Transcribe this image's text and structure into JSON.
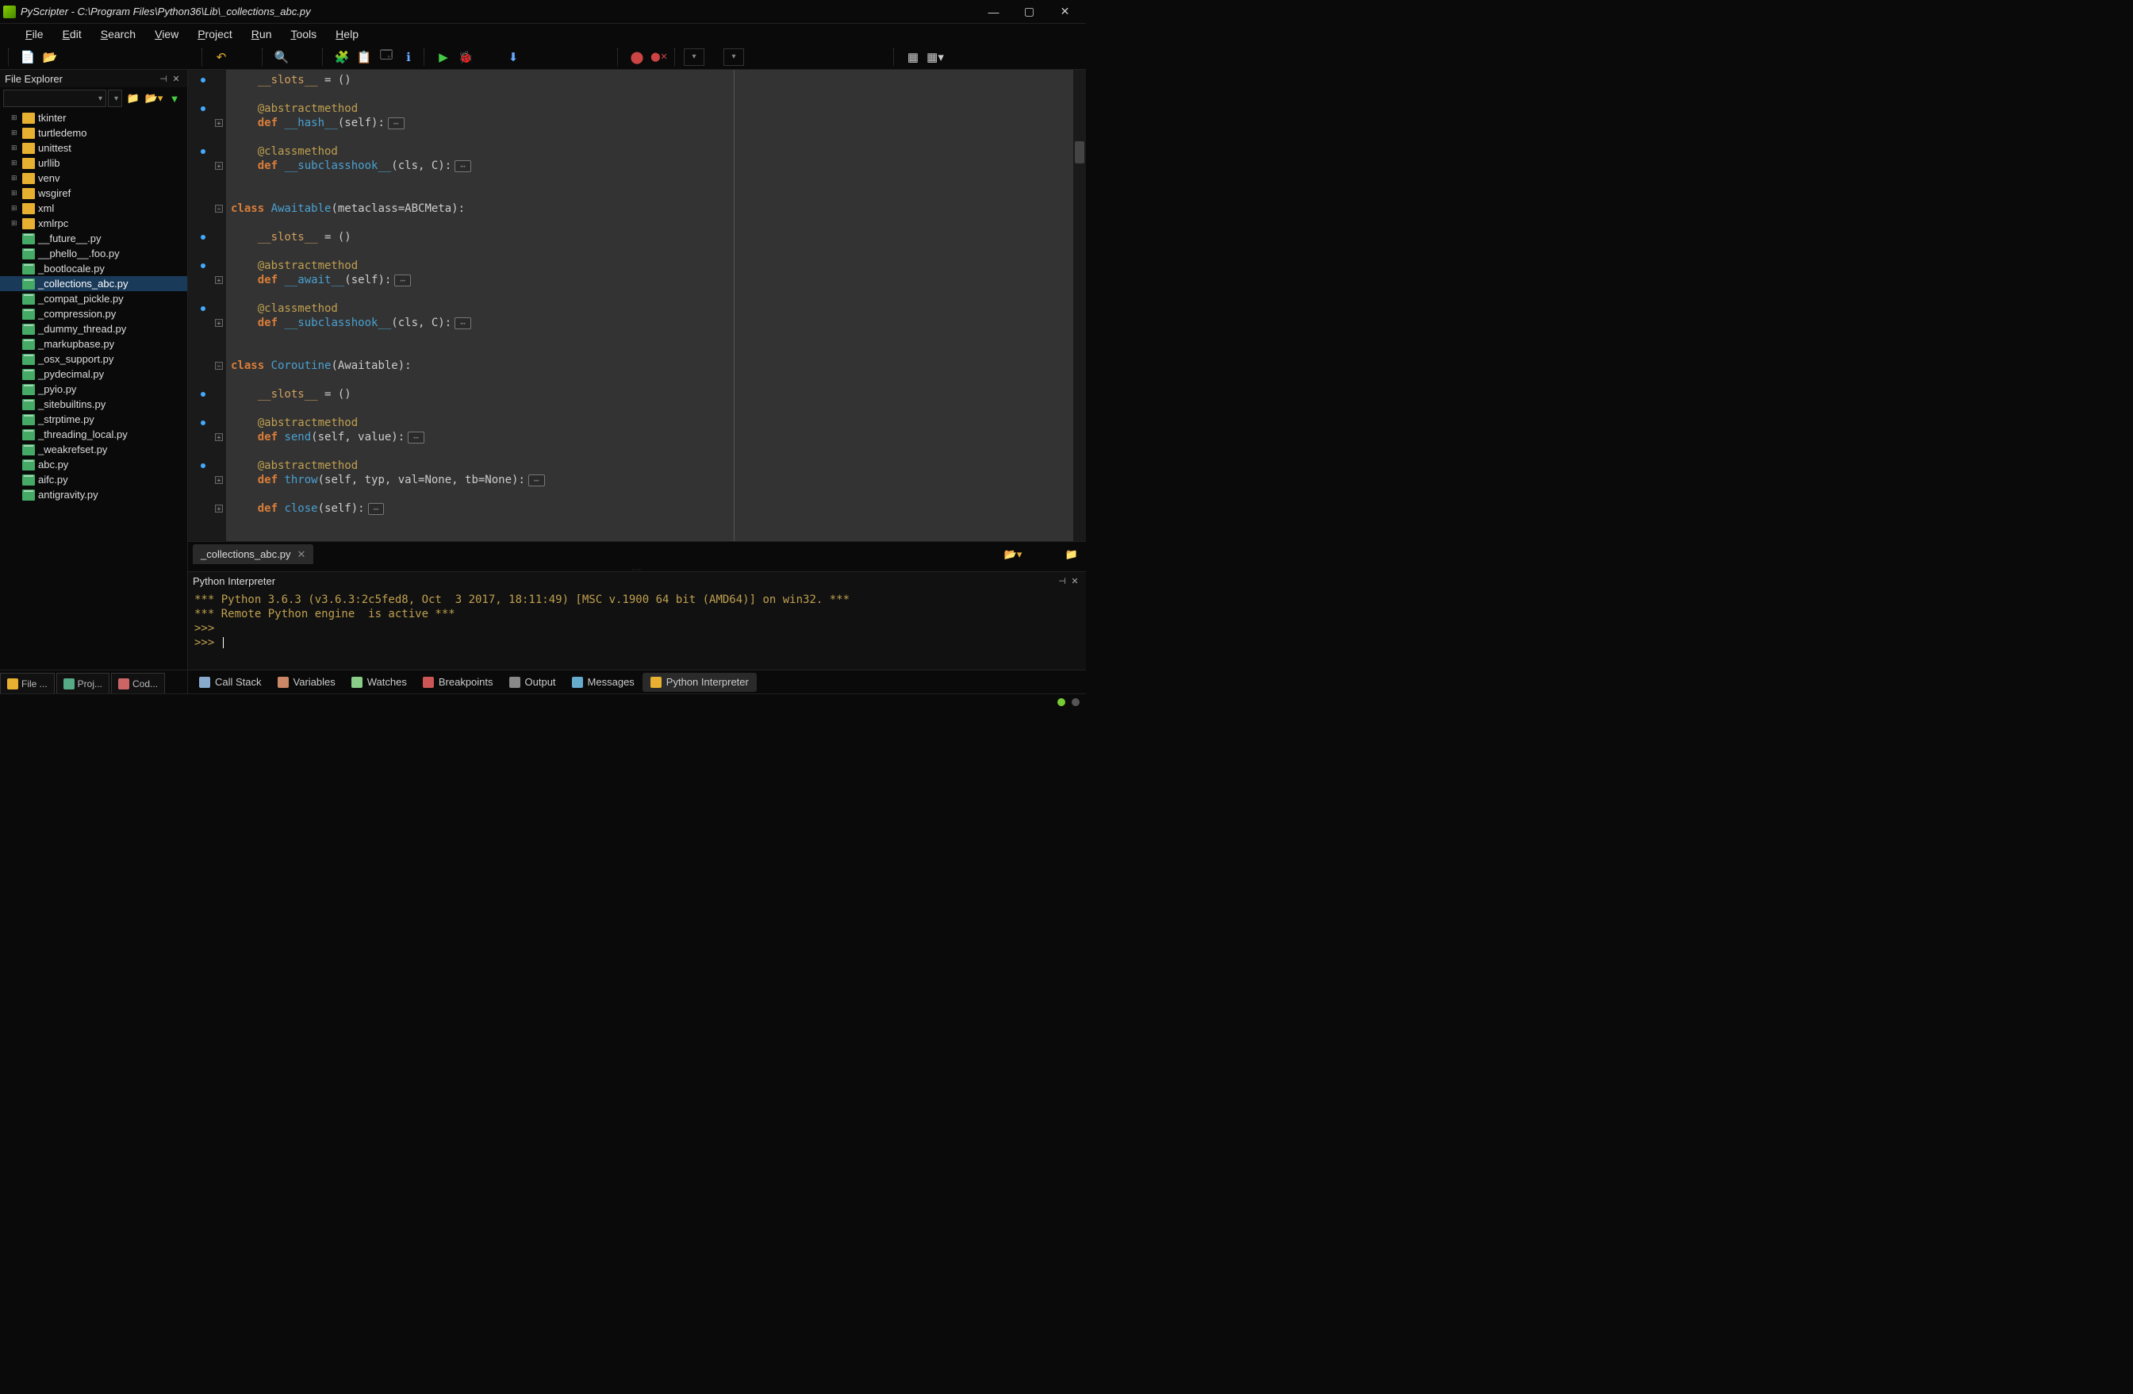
{
  "window": {
    "title": "PyScripter - C:\\Program Files\\Python36\\Lib\\_collections_abc.py"
  },
  "menu": [
    "File",
    "Edit",
    "Search",
    "View",
    "Project",
    "Run",
    "Tools",
    "Help"
  ],
  "explorer": {
    "title": "File Explorer",
    "items": [
      {
        "type": "folder",
        "expander": "+",
        "name": "tkinter"
      },
      {
        "type": "folder",
        "expander": "+",
        "name": "turtledemo"
      },
      {
        "type": "folder",
        "expander": "+",
        "name": "unittest"
      },
      {
        "type": "folder",
        "expander": "+",
        "name": "urllib"
      },
      {
        "type": "folder",
        "expander": "+",
        "name": "venv"
      },
      {
        "type": "folder",
        "expander": "+",
        "name": "wsgiref"
      },
      {
        "type": "folder",
        "expander": "+",
        "name": "xml"
      },
      {
        "type": "folder",
        "expander": "+",
        "name": "xmlrpc"
      },
      {
        "type": "file",
        "name": "__future__.py"
      },
      {
        "type": "file",
        "name": "__phello__.foo.py"
      },
      {
        "type": "file",
        "name": "_bootlocale.py"
      },
      {
        "type": "file",
        "name": "_collections_abc.py",
        "selected": true
      },
      {
        "type": "file",
        "name": "_compat_pickle.py"
      },
      {
        "type": "file",
        "name": "_compression.py"
      },
      {
        "type": "file",
        "name": "_dummy_thread.py"
      },
      {
        "type": "file",
        "name": "_markupbase.py"
      },
      {
        "type": "file",
        "name": "_osx_support.py"
      },
      {
        "type": "file",
        "name": "_pydecimal.py"
      },
      {
        "type": "file",
        "name": "_pyio.py"
      },
      {
        "type": "file",
        "name": "_sitebuiltins.py"
      },
      {
        "type": "file",
        "name": "_strptime.py"
      },
      {
        "type": "file",
        "name": "_threading_local.py"
      },
      {
        "type": "file",
        "name": "_weakrefset.py"
      },
      {
        "type": "file",
        "name": "abc.py"
      },
      {
        "type": "file",
        "name": "aifc.py"
      },
      {
        "type": "file",
        "name": "antigravity.py"
      }
    ]
  },
  "sideTabs": [
    {
      "label": "File ...",
      "icon": "#e8b030"
    },
    {
      "label": "Proj...",
      "icon": "#5a8"
    },
    {
      "label": "Cod...",
      "icon": "#c66"
    }
  ],
  "editor": {
    "tab": "_collections_abc.py",
    "code": [
      {
        "indent": "    ",
        "tokens": [
          {
            "t": "__slots__",
            "c": "slots"
          },
          {
            "t": " = ()",
            "c": "punc"
          }
        ],
        "change": true
      },
      {
        "indent": "",
        "tokens": []
      },
      {
        "indent": "    ",
        "tokens": [
          {
            "t": "@abstractmethod",
            "c": "dec"
          }
        ],
        "change": true
      },
      {
        "indent": "    ",
        "tokens": [
          {
            "t": "def ",
            "c": "kw"
          },
          {
            "t": "__hash__",
            "c": "fn"
          },
          {
            "t": "(self):",
            "c": "punc"
          }
        ],
        "fold": "+",
        "collapsed": true
      },
      {
        "indent": "",
        "tokens": []
      },
      {
        "indent": "    ",
        "tokens": [
          {
            "t": "@classmethod",
            "c": "dec"
          }
        ],
        "change": true
      },
      {
        "indent": "    ",
        "tokens": [
          {
            "t": "def ",
            "c": "kw"
          },
          {
            "t": "__subclasshook__",
            "c": "fn"
          },
          {
            "t": "(cls, C):",
            "c": "punc"
          }
        ],
        "fold": "+",
        "collapsed": true
      },
      {
        "indent": "",
        "tokens": []
      },
      {
        "indent": "",
        "tokens": []
      },
      {
        "indent": "",
        "tokens": [
          {
            "t": "class ",
            "c": "kw"
          },
          {
            "t": "Awaitable",
            "c": "cls"
          },
          {
            "t": "(metaclass=ABCMeta):",
            "c": "punc"
          }
        ],
        "fold": "-"
      },
      {
        "indent": "",
        "tokens": []
      },
      {
        "indent": "    ",
        "tokens": [
          {
            "t": "__slots__",
            "c": "slots"
          },
          {
            "t": " = ()",
            "c": "punc"
          }
        ],
        "change": true
      },
      {
        "indent": "",
        "tokens": []
      },
      {
        "indent": "    ",
        "tokens": [
          {
            "t": "@abstractmethod",
            "c": "dec"
          }
        ],
        "change": true
      },
      {
        "indent": "    ",
        "tokens": [
          {
            "t": "def ",
            "c": "kw"
          },
          {
            "t": "__await__",
            "c": "fn"
          },
          {
            "t": "(self):",
            "c": "punc"
          }
        ],
        "fold": "+",
        "collapsed": true
      },
      {
        "indent": "",
        "tokens": []
      },
      {
        "indent": "    ",
        "tokens": [
          {
            "t": "@classmethod",
            "c": "dec"
          }
        ],
        "change": true
      },
      {
        "indent": "    ",
        "tokens": [
          {
            "t": "def ",
            "c": "kw"
          },
          {
            "t": "__subclasshook__",
            "c": "fn"
          },
          {
            "t": "(cls, C):",
            "c": "punc"
          }
        ],
        "fold": "+",
        "collapsed": true
      },
      {
        "indent": "",
        "tokens": []
      },
      {
        "indent": "",
        "tokens": []
      },
      {
        "indent": "",
        "tokens": [
          {
            "t": "class ",
            "c": "kw"
          },
          {
            "t": "Coroutine",
            "c": "cls"
          },
          {
            "t": "(Awaitable):",
            "c": "punc"
          }
        ],
        "fold": "-"
      },
      {
        "indent": "",
        "tokens": []
      },
      {
        "indent": "    ",
        "tokens": [
          {
            "t": "__slots__",
            "c": "slots"
          },
          {
            "t": " = ()",
            "c": "punc"
          }
        ],
        "change": true
      },
      {
        "indent": "",
        "tokens": []
      },
      {
        "indent": "    ",
        "tokens": [
          {
            "t": "@abstractmethod",
            "c": "dec"
          }
        ],
        "change": true
      },
      {
        "indent": "    ",
        "tokens": [
          {
            "t": "def ",
            "c": "kw"
          },
          {
            "t": "send",
            "c": "fn"
          },
          {
            "t": "(self, value):",
            "c": "punc"
          }
        ],
        "fold": "+",
        "collapsed": true
      },
      {
        "indent": "",
        "tokens": []
      },
      {
        "indent": "    ",
        "tokens": [
          {
            "t": "@abstractmethod",
            "c": "dec"
          }
        ],
        "change": true
      },
      {
        "indent": "    ",
        "tokens": [
          {
            "t": "def ",
            "c": "kw"
          },
          {
            "t": "throw",
            "c": "fn"
          },
          {
            "t": "(self, typ, val=None, tb=None):",
            "c": "punc"
          }
        ],
        "fold": "+",
        "collapsed": true
      },
      {
        "indent": "",
        "tokens": []
      },
      {
        "indent": "    ",
        "tokens": [
          {
            "t": "def ",
            "c": "kw"
          },
          {
            "t": "close",
            "c": "fn"
          },
          {
            "t": "(self):",
            "c": "punc"
          }
        ],
        "fold": "+",
        "collapsed": true
      }
    ]
  },
  "interpreter": {
    "title": "Python Interpreter",
    "lines": [
      "*** Python 3.6.3 (v3.6.3:2c5fed8, Oct  3 2017, 18:11:49) [MSC v.1900 64 bit (AMD64)] on win32. ***",
      "*** Remote Python engine  is active ***",
      ">>>",
      ">>> "
    ]
  },
  "bottomTabs": [
    {
      "label": "Call Stack",
      "icon": "#8ac"
    },
    {
      "label": "Variables",
      "icon": "#c86"
    },
    {
      "label": "Watches",
      "icon": "#8c8"
    },
    {
      "label": "Breakpoints",
      "icon": "#c55"
    },
    {
      "label": "Output",
      "icon": "#888"
    },
    {
      "label": "Messages",
      "icon": "#6ac"
    },
    {
      "label": "Python Interpreter",
      "icon": "#e8b030",
      "active": true
    }
  ],
  "status_dots": [
    "#7c3",
    "#555"
  ],
  "colors": {
    "accent": "#d97d3a"
  }
}
